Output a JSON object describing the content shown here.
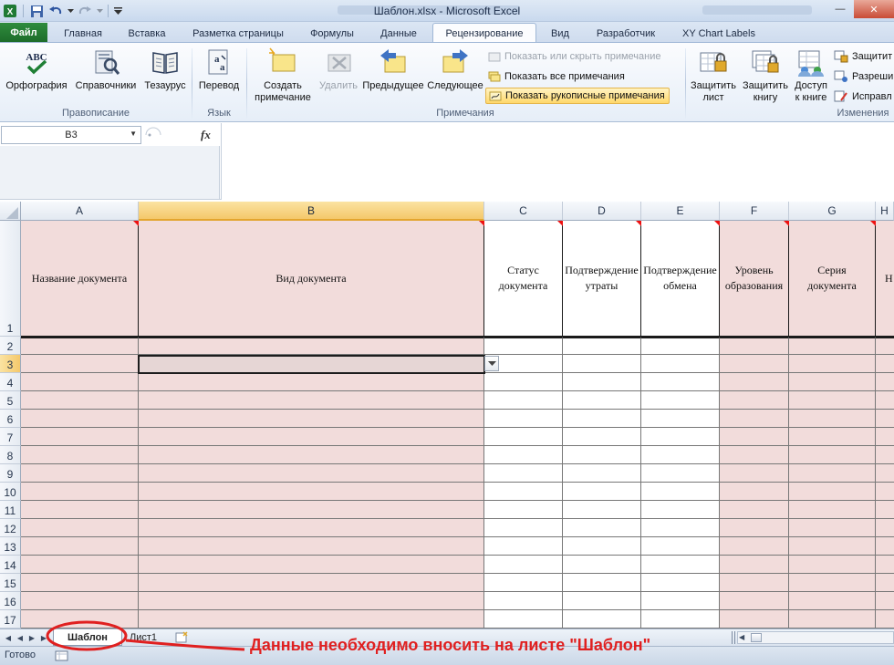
{
  "window": {
    "title": "Шаблон.xlsx - Microsoft Excel"
  },
  "ribbon_tabs": [
    {
      "label": "Файл"
    },
    {
      "label": "Главная"
    },
    {
      "label": "Вставка"
    },
    {
      "label": "Разметка страницы"
    },
    {
      "label": "Формулы"
    },
    {
      "label": "Данные"
    },
    {
      "label": "Рецензирование"
    },
    {
      "label": "Вид"
    },
    {
      "label": "Разработчик"
    },
    {
      "label": "XY Chart Labels"
    }
  ],
  "ribbon": {
    "proofing": {
      "spelling": "Орфография",
      "research": "Справочники",
      "thesaurus": "Тезаурус",
      "group": "Правописание"
    },
    "language": {
      "translate": "Перевод",
      "group": "Язык"
    },
    "comments": {
      "new_line1": "Создать",
      "new_line2": "примечание",
      "delete": "Удалить",
      "previous": "Предыдущее",
      "next": "Следующее",
      "show_hide": "Показать или скрыть примечание",
      "show_all": "Показать все примечания",
      "show_ink": "Показать рукописные примечания",
      "group": "Примечания"
    },
    "changes": {
      "protect_sheet_1": "Защитить",
      "protect_sheet_2": "лист",
      "protect_book_1": "Защитить",
      "protect_book_2": "книгу",
      "share_1": "Доступ",
      "share_2": "к книге",
      "protect_share": "Защитит",
      "allow_edit": "Разреши",
      "track": "Исправл",
      "group": "Изменения"
    }
  },
  "formula_bar": {
    "name_box": "B3",
    "fx": "fx",
    "content": ""
  },
  "columns": [
    "A",
    "B",
    "C",
    "D",
    "E",
    "F",
    "G",
    "H"
  ],
  "header_cells": {
    "A": "Название документа",
    "B": "Вид документа",
    "C": "Статус документа",
    "D": "Подтверждение утраты",
    "E": "Подтверждение обмена",
    "F": "Уровень образования",
    "G": "Серия документа",
    "H": "Н"
  },
  "rows": [
    "1",
    "2",
    "3",
    "4",
    "5",
    "6",
    "7",
    "8",
    "9",
    "10",
    "11",
    "12",
    "13",
    "14",
    "15",
    "16",
    "17"
  ],
  "sheets": [
    {
      "label": "Шаблон",
      "active": true
    },
    {
      "label": "Лист1",
      "active": false
    }
  ],
  "status": {
    "ready": "Готово"
  },
  "annotation": {
    "text": "Данные необходимо вносить на листе \"Шаблон\""
  },
  "colors": {
    "pink_fill": "#f2dcdb",
    "file_tab": "#217a32",
    "annotation": "#e02020",
    "selected_header": "#f4c86b"
  }
}
